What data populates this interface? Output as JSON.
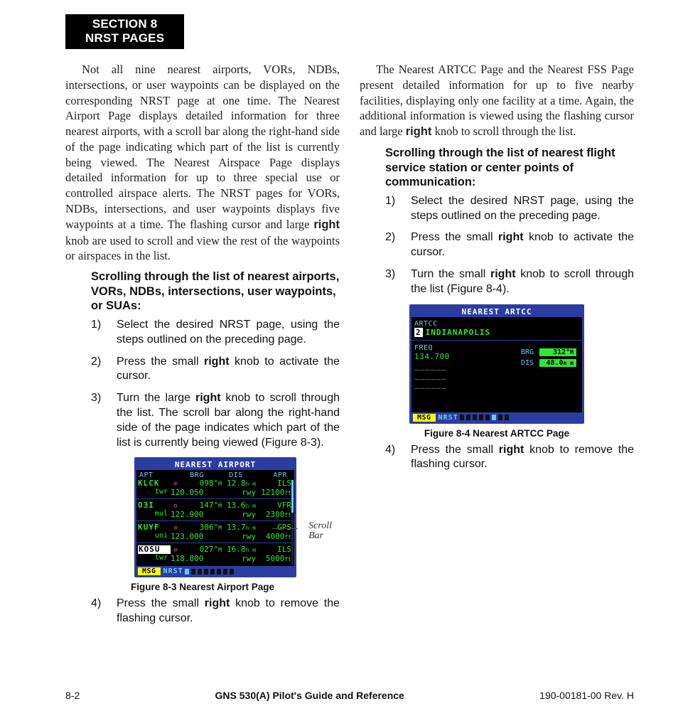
{
  "section_tab": "SECTION 8\nNRST PAGES",
  "left": {
    "para1_a": "Not all nine nearest airports, VORs, NDBs, intersections, or user waypoints can be displayed on the corresponding NRST page at one time.  The Nearest Airport Page displays detailed information for three nearest airports, with a scroll bar along the right-hand side of the page indicating which part of the list is currently being viewed.  The Nearest Airspace Page displays detailed information for up to three special use or controlled airspace alerts.  The NRST pages for VORs, NDBs, intersections, and user waypoints displays five waypoints at a time.  The flashing cursor and large ",
    "para1_b": "right",
    "para1_c": " knob are used to scroll and view the rest of the waypoints or airspaces in the list.",
    "subhead": "Scrolling through the list of nearest airports, VORs, NDBs, intersections, user waypoints, or SUAs:",
    "steps": {
      "s1": "Select the desired NRST page, using the steps outlined on the preceding page.",
      "s2_a": "Press the small ",
      "s2_b": "right",
      "s2_c": " knob to activate the cursor.",
      "s3_a": "Turn the large ",
      "s3_b": "right",
      "s3_c": " knob to scroll through the list.  The scroll bar along the right-hand side of the page indicates which part of the list is currently being viewed (Figure 8-3)."
    },
    "fig": {
      "title": "NEAREST AIRPORT",
      "hdr": {
        "apt": "APT",
        "brg": "BRG",
        "dis": "DIS",
        "apr": "APR"
      },
      "rows": [
        {
          "id": "KLCK",
          "sym": "⊘",
          "brg": "098°",
          "brgu": "M",
          "dis": "12.8",
          "disu": "n m",
          "apr": "ILS",
          "sub": "twr",
          "freq": "120.050",
          "rwy": "rwy",
          "rwyv": "12100",
          "ft": "ft"
        },
        {
          "id": "O3I",
          "sym": "o",
          "brg": "147°",
          "brgu": "M",
          "dis": "13.6",
          "disu": "n m",
          "apr": "VFR",
          "sub": "mul",
          "freq": "122.900",
          "rwy": "rwy",
          "rwyv": "2300",
          "ft": "ft"
        },
        {
          "id": "KUYF",
          "sym": "⊖",
          "brg": "306°",
          "brgu": "M",
          "dis": "13.7",
          "disu": "n m",
          "apr": "GPS",
          "sub": "uni",
          "freq": "123.000",
          "rwy": "rwy",
          "rwyv": "4000",
          "ft": "ft"
        },
        {
          "id": "KOSU",
          "sym": "⊘",
          "brg": "027°",
          "brgu": "M",
          "dis": "16.8",
          "disu": "n m",
          "apr": "ILS",
          "sub": "twr",
          "freq": "118.800",
          "rwy": "rwy",
          "rwyv": "5000",
          "ft": "ft",
          "hi": true
        }
      ],
      "msg": "MSG",
      "nrst": "NRST",
      "callout": "Scroll\nBar",
      "caption": "Figure 8-3  Nearest Airport Page"
    },
    "s4_a": "Press the small ",
    "s4_b": "right",
    "s4_c": " knob to remove the flashing cursor."
  },
  "right": {
    "para1_a": "The Nearest ARTCC Page and the Nearest FSS Page present detailed information for up to five nearby facilities, displaying only one facility at a time.  Again, the additional information is viewed using the flashing cursor and large ",
    "para1_b": "right",
    "para1_c": " knob to scroll through the list.",
    "subhead": "Scrolling through the list of nearest flight service station or center points of communication:",
    "steps": {
      "s1": "Select the desired NRST page, using the steps outlined on the preceding page.",
      "s2_a": "Press the small ",
      "s2_b": "right",
      "s2_c": " knob to activate the cursor.",
      "s3_a": "Turn the small ",
      "s3_b": "right",
      "s3_c": " knob to scroll through the list (Figure 8-4)."
    },
    "fig": {
      "title": "NEAREST ARTCC",
      "artcc_label": "ARTCC",
      "idx": "2",
      "name": "INDIANAPOLIS",
      "freq_label": "FREQ",
      "freq": "134.700",
      "blanks": [
        "______",
        "______",
        "______"
      ],
      "brg_label": "BRG",
      "brg": "312°",
      "brgu": "M",
      "dis_label": "DIS",
      "dis": "48.0",
      "disu": "n m",
      "msg": "MSG",
      "nrst": "NRST",
      "caption": "Figure 8-4  Nearest ARTCC Page"
    },
    "s4_a": "Press the small ",
    "s4_b": "right",
    "s4_c": " knob to remove the flashing cursor."
  },
  "footer": {
    "left": "8-2",
    "mid": "GNS 530(A) Pilot's Guide and Reference",
    "right": "190-00181-00  Rev. H"
  }
}
